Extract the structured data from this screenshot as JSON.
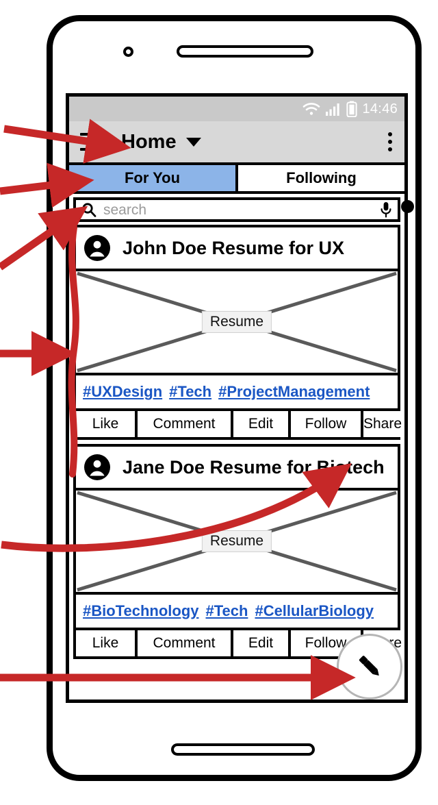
{
  "device": {
    "frame": "hand-drawn-phone-mockup",
    "camera": "camera-dot",
    "speaker": "earpiece-speaker",
    "home_indicator": "home-bar"
  },
  "status_bar": {
    "time": "14:46",
    "icons": [
      "wifi-icon",
      "cellular-signal-icon",
      "battery-icon"
    ]
  },
  "app_bar": {
    "menu_icon": "hamburger-menu-icon",
    "title": "Home",
    "caret_icon": "chevron-down-icon",
    "overflow_icon": "three-dot-overflow-icon"
  },
  "tabs": [
    {
      "label": "For You",
      "active": true
    },
    {
      "label": "Following",
      "active": false
    }
  ],
  "search": {
    "placeholder": "search",
    "value": "",
    "search_icon": "search-icon",
    "mic_icon": "microphone-icon"
  },
  "feed": {
    "posts": [
      {
        "avatar_icon": "user-avatar-icon",
        "title": "John Doe Resume for UX",
        "image_label": "Resume",
        "image_placeholder": "crossed-box-image-placeholder",
        "tags": [
          "#UXDesign",
          "#Tech",
          "#ProjectManagement"
        ],
        "actions": [
          "Like",
          "Comment",
          "Edit",
          "Follow",
          "Share"
        ]
      },
      {
        "avatar_icon": "user-avatar-icon",
        "title": "Jane Doe Resume for Biotech",
        "image_label": "Resume",
        "image_placeholder": "crossed-box-image-placeholder",
        "tags": [
          "#BioTechnology",
          "#Tech",
          "#CellularBiology"
        ],
        "actions": [
          "Like",
          "Comment",
          "Edit",
          "Follow",
          "Share"
        ]
      }
    ]
  },
  "fab": {
    "icon": "pencil-compose-icon",
    "label": ""
  },
  "annotations": {
    "color": "#c62828",
    "markers": [
      {
        "name": "arrow-to-hamburger-menu",
        "target": "hamburger-menu-icon"
      },
      {
        "name": "arrow-to-for-you-tab",
        "target": "tab-for-you"
      },
      {
        "name": "arrow-to-search-bar",
        "target": "search-input"
      },
      {
        "name": "arrow-to-post-card-brace",
        "target": "post-card-1"
      },
      {
        "name": "curved-arrow-to-share-button",
        "target": "post-1-share-button"
      },
      {
        "name": "arrow-to-compose-fab",
        "target": "fab-compose"
      }
    ]
  },
  "colors": {
    "tab_active": "#8cb4e8",
    "status_bar": "#c9c9c9",
    "app_bar": "#d8d8d8",
    "link": "#1a56c4",
    "annotation_red": "#c62828",
    "placeholder_text": "#9a9a9a"
  }
}
